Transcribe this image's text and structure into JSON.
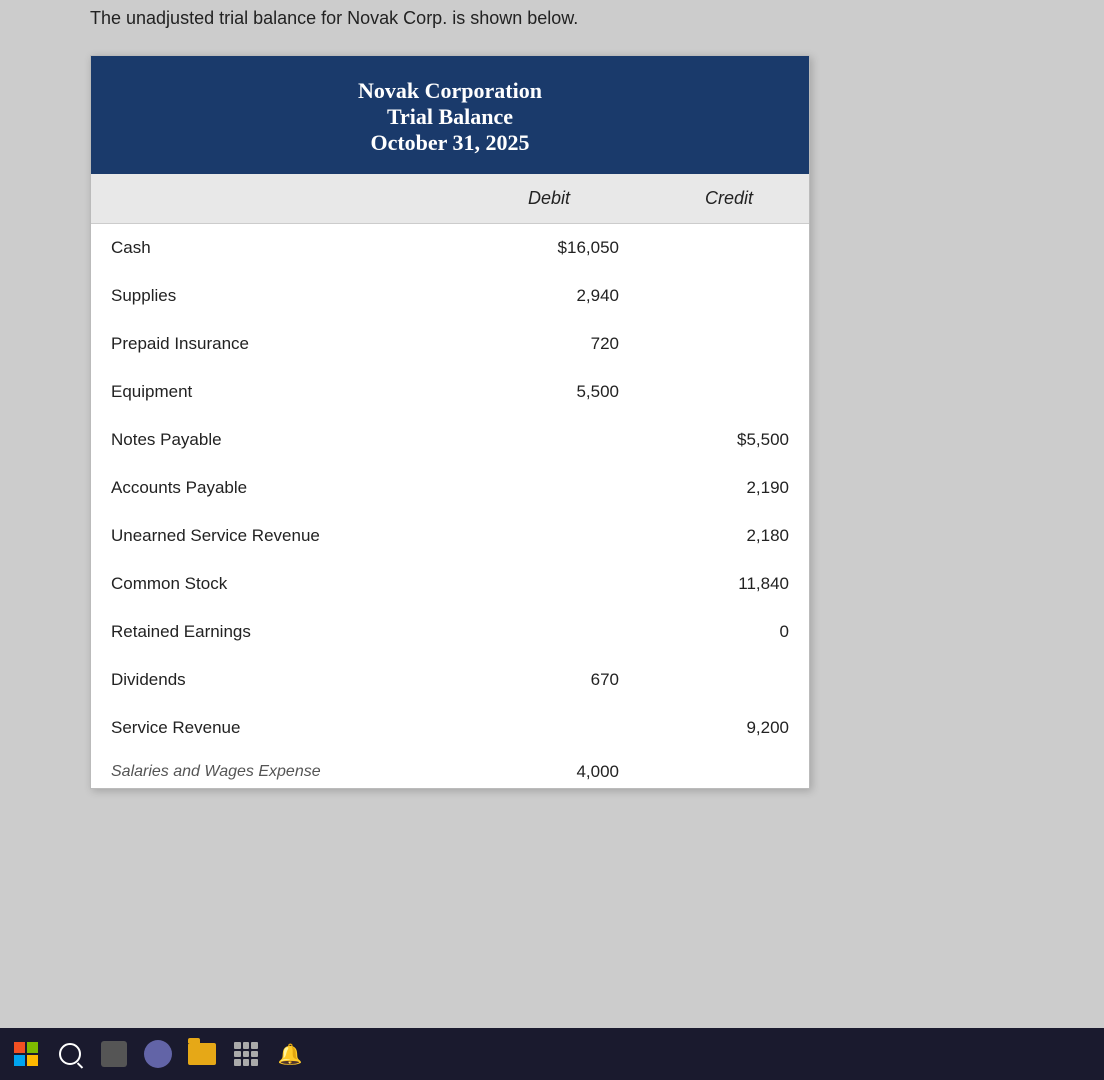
{
  "intro": {
    "text": "The unadjusted trial balance for Novak Corp. is shown below."
  },
  "table": {
    "header": {
      "corp_name": "Novak Corporation",
      "title": "Trial Balance",
      "date": "October 31, 2025"
    },
    "columns": {
      "account": "",
      "debit": "Debit",
      "credit": "Credit"
    },
    "rows": [
      {
        "account": "Cash",
        "debit": "$16,050",
        "credit": ""
      },
      {
        "account": "Supplies",
        "debit": "2,940",
        "credit": ""
      },
      {
        "account": "Prepaid Insurance",
        "debit": "720",
        "credit": ""
      },
      {
        "account": "Equipment",
        "debit": "5,500",
        "credit": ""
      },
      {
        "account": "Notes Payable",
        "debit": "",
        "credit": "$5,500"
      },
      {
        "account": "Accounts Payable",
        "debit": "",
        "credit": "2,190"
      },
      {
        "account": "Unearned Service Revenue",
        "debit": "",
        "credit": "2,180"
      },
      {
        "account": "Common Stock",
        "debit": "",
        "credit": "11,840"
      },
      {
        "account": "Retained Earnings",
        "debit": "",
        "credit": "0"
      },
      {
        "account": "Dividends",
        "debit": "670",
        "credit": ""
      },
      {
        "account": "Service Revenue",
        "debit": "",
        "credit": "9,200"
      },
      {
        "account": "Salaries and Wages Expense",
        "debit": "4,000",
        "credit": ""
      }
    ]
  }
}
